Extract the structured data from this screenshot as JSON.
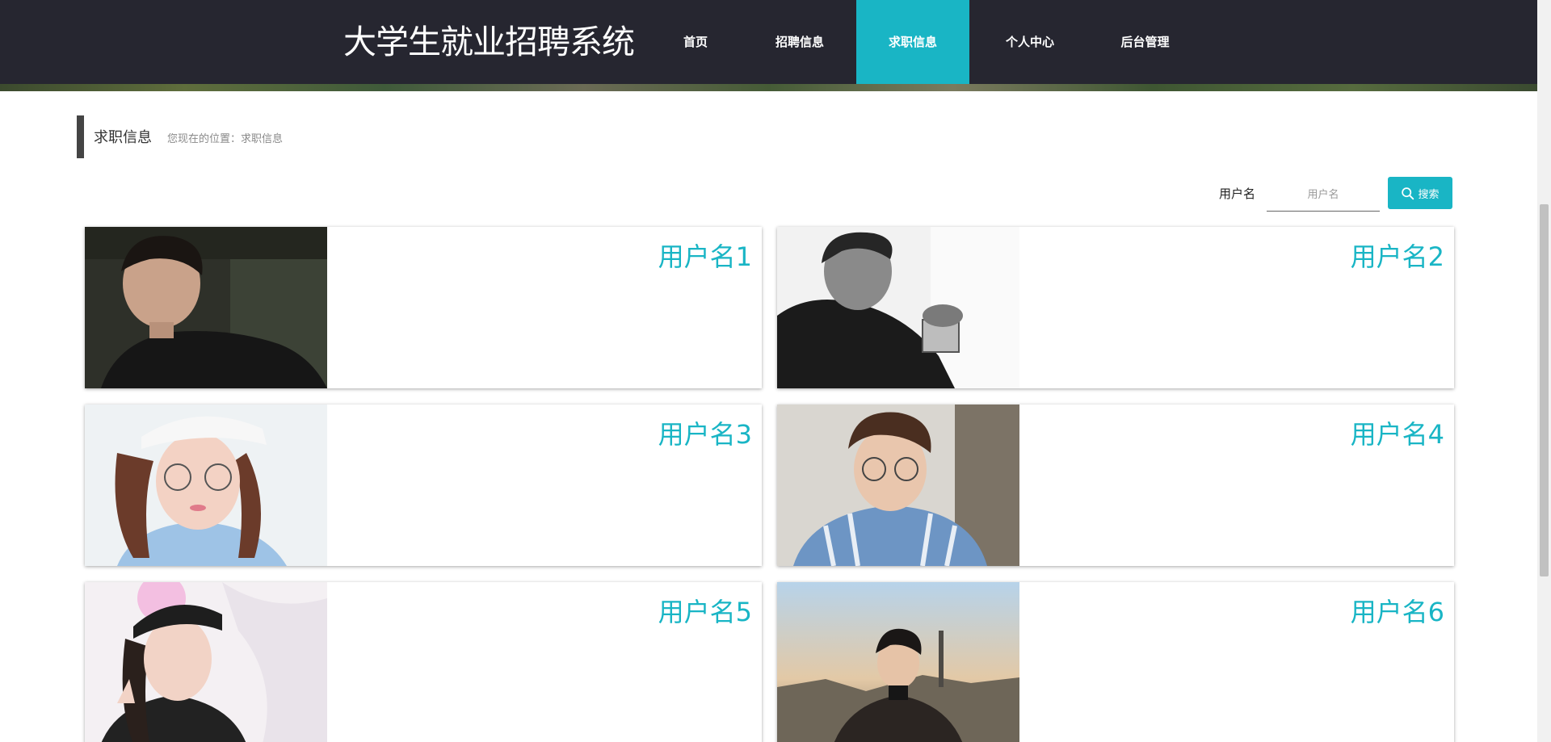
{
  "header": {
    "site_title": "大学生就业招聘系统",
    "nav": [
      {
        "label": "首页",
        "active": false
      },
      {
        "label": "招聘信息",
        "active": false
      },
      {
        "label": "求职信息",
        "active": true
      },
      {
        "label": "个人中心",
        "active": false
      },
      {
        "label": "后台管理",
        "active": false
      }
    ]
  },
  "page": {
    "section_title": "求职信息",
    "breadcrumb": "您现在的位置：求职信息"
  },
  "search": {
    "label": "用户名",
    "placeholder": "用户名",
    "value": "",
    "button_label": "搜索",
    "button_icon": "search-icon"
  },
  "cards": [
    {
      "username": "用户名1"
    },
    {
      "username": "用户名2"
    },
    {
      "username": "用户名3"
    },
    {
      "username": "用户名4"
    },
    {
      "username": "用户名5"
    },
    {
      "username": "用户名6"
    }
  ],
  "colors": {
    "accent": "#19b5c5",
    "header_bg": "#262630",
    "text_dark": "#333333",
    "breadcrumb": "#8a8a8a"
  }
}
